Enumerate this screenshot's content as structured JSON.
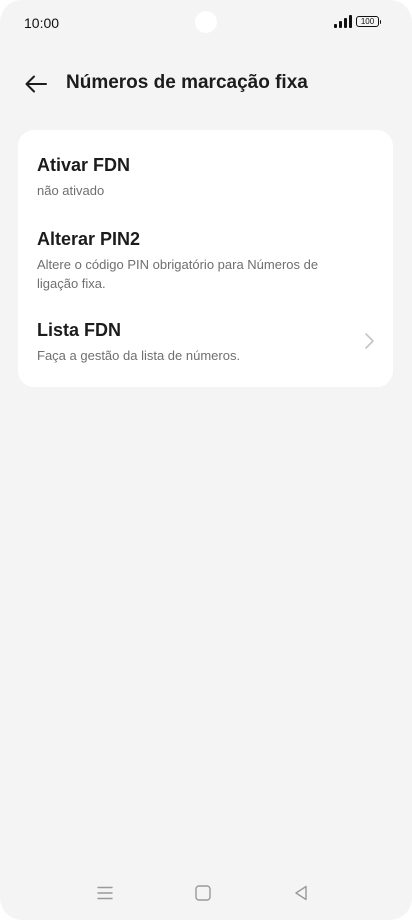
{
  "status_bar": {
    "time": "10:00",
    "battery": "100",
    "signal_icon": "signal-bars-icon"
  },
  "header": {
    "back_icon": "arrow-left-icon",
    "title": "Números de marcação fixa"
  },
  "settings": {
    "items": [
      {
        "title": "Ativar FDN",
        "subtitle": "não ativado",
        "has_chevron": false
      },
      {
        "title": "Alterar PIN2",
        "subtitle": "Altere o código PIN obrigatório para Números de ligação fixa.",
        "has_chevron": false
      },
      {
        "title": "Lista FDN",
        "subtitle": "Faça a gestão da lista de números.",
        "has_chevron": true,
        "chevron_icon": "chevron-right-icon"
      }
    ]
  },
  "nav_bar": {
    "icons": [
      "menu-icon",
      "home-square-icon",
      "back-triangle-icon"
    ]
  },
  "colors": {
    "background": "#f4f4f4",
    "card": "#ffffff",
    "title_text": "#1c1c1c",
    "secondary_text": "#6f6f6f"
  }
}
